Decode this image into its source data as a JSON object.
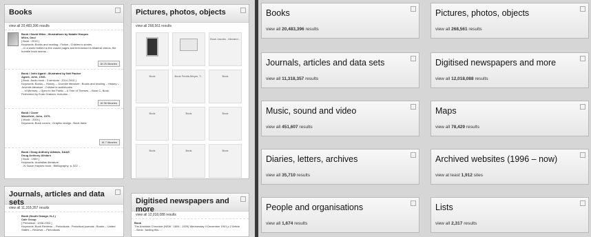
{
  "left": {
    "books": {
      "title": "Books",
      "view_all": "view all 20,483,396 results",
      "items": [
        {
          "title": "Book / David Miles ; illustrations by Natalie Hoopes",
          "author": "Miles, Davi",
          "format": "[ Book : 2015 ]",
          "keywords": "Keywords: Books and reading ; Fiction ; Children's stories",
          "snippet": "...in a world bottled to the closed pages and text-locked in bilateral videos, the humble book seems ...",
          "libs": "At 25 libraries"
        },
        {
          "title": "Book / John Agard ; illustrated by Neil Packer",
          "author": "Agard, John, 1949-",
          "format": "[ Book, Audio book : 3 versions : 2014-2015 ]",
          "keywords": "Keywords: Books -- History -- Juvenile literature ; Books and reading -- History -- Juvenile literature ; Children's audiobooks",
          "snippet": "... of Memory -- Open to the Public -- A Tree of Themes -- Book C- Book. Performed by Evan Graham. Includes ...",
          "libs": "At 36 libraries"
        },
        {
          "title": "Book / Cover",
          "author": "Mansfield, John, 1979-",
          "format": "[ Music : 2004 ]",
          "keywords": "Keywords: Book covers ; Graphic design ; Book trade",
          "snippet": "",
          "libs": "At 7 libraries"
        },
        {
          "title": "Book / Doug Anthony Allstars, DAAS",
          "author": "Doug Anthony Allstars",
          "format": "[ Book : 1989 ]",
          "keywords": "Keywords: Australian literature.",
          "snippet": "...N Susan Haynes book ; Bibliography: p. 522 ...",
          "libs": "At 15 libraries"
        }
      ]
    },
    "pictures": {
      "title": "Pictures, photos, objects",
      "view_all": "view all 268,561 results",
      "cells": [
        {
          "label": "",
          "img": "img1"
        },
        {
          "label": "",
          "img": "img2"
        },
        {
          "label": "Book Jacobs , Alexand...",
          "img": ""
        },
        {
          "label": "Book",
          "img": ""
        },
        {
          "label": "Book Fedds-Meyer, T...",
          "img": ""
        },
        {
          "label": "Book",
          "img": ""
        },
        {
          "label": "Book",
          "img": ""
        },
        {
          "label": "Book",
          "img": ""
        },
        {
          "label": "Book",
          "img": ""
        },
        {
          "label": "Book",
          "img": ""
        },
        {
          "label": "Book",
          "img": ""
        },
        {
          "label": "Book",
          "img": ""
        }
      ]
    },
    "journals": {
      "title": "Journals, articles and data sets",
      "view_all": "view all 11,318,357 results",
      "item_title": "Book (South Orange, N.J.)",
      "item_author": "Cale Group",
      "item_format": "[ Periodical : 1938-2003 ]",
      "item_keywords": "Keywords: Book Reviews -- Periodicals ; Periodical journals ; Books -- United States -- Reviews -- Periodicals"
    },
    "newspapers": {
      "title": "Digitised newspapers and more",
      "view_all": "view all 12,018,088 results",
      "item_title": "Book",
      "item_source": "The Armidale Chronicle (NSW : 1894 - 1929) Wednesday 4 December 1901 p 2 Article",
      "item_snippet": "...Book: 'Adding this ...'"
    }
  },
  "right": {
    "panels": [
      {
        "title": "Books",
        "pre": "view all ",
        "count": "20,483,396",
        "post": " results"
      },
      {
        "title": "Pictures, photos, objects",
        "pre": "view all ",
        "count": "268,561",
        "post": " results"
      },
      {
        "title": "Journals, articles and data sets",
        "pre": "view all ",
        "count": "11,318,357",
        "post": " results"
      },
      {
        "title": "Digitised newspapers and more",
        "pre": "view all ",
        "count": "12,018,088",
        "post": " results"
      },
      {
        "title": "Music, sound and video",
        "pre": "view all ",
        "count": "451,607",
        "post": " results"
      },
      {
        "title": "Maps",
        "pre": "view all ",
        "count": "78,429",
        "post": " results"
      },
      {
        "title": "Diaries, letters, archives",
        "pre": "view all ",
        "count": "35,710",
        "post": " results"
      },
      {
        "title": "Archived websites (1996 – now)",
        "pre": "view at least ",
        "count": "1,912",
        "post": " sites"
      },
      {
        "title": "People and organisations",
        "pre": "view all ",
        "count": "1,674",
        "post": " results"
      },
      {
        "title": "Lists",
        "pre": "view all ",
        "count": "2,317",
        "post": " results"
      }
    ]
  }
}
